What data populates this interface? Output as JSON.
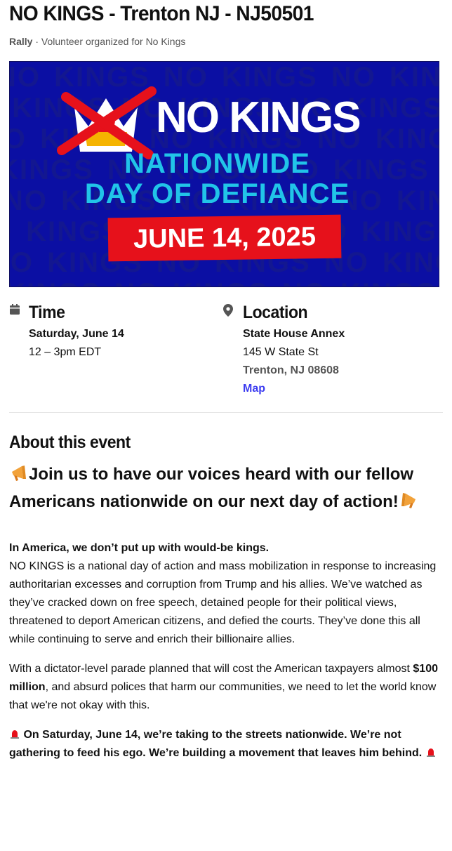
{
  "event": {
    "title": "NO KINGS - Trenton NJ - NJ50501",
    "type": "Rally",
    "organizer_text": "· Volunteer organized for No Kings"
  },
  "banner": {
    "line1": "NO KINGS",
    "line2": "NATIONWIDE",
    "line3": "DAY OF DEFIANCE",
    "date": "JUNE 14, 2025",
    "bg_word": "NO KINGS",
    "colors": {
      "background": "#0b0fa3",
      "accent": "#21c4e8",
      "date_plate": "#e6111b"
    }
  },
  "time": {
    "heading": "Time",
    "date": "Saturday, June 14",
    "hours": "12 – 3pm EDT",
    "icon": "calendar-icon"
  },
  "location": {
    "heading": "Location",
    "venue": "State House Annex",
    "street": "145 W State St",
    "city": "Trenton, NJ 08608",
    "map_link": "Map",
    "icon": "map-pin-icon"
  },
  "about": {
    "heading": "About this event",
    "headline": "Join us to have our voices heard with our fellow Americans nationwide on our next day of action!",
    "intro_bold": "In America, we don’t put up with would-be kings.",
    "para1": "NO KINGS is a national day of action and mass mobilization in response to increasing authoritarian excesses and corruption from Trump and his allies. We’ve watched as they’ve cracked down on free speech, detained people for their political views, threatened to deport American citizens, and defied the courts. They’ve done this all while continuing to serve and enrich their billionaire allies.",
    "para2_before": "With a dictator-level parade planned that will cost the American taxpayers almost ",
    "para2_bold": "$100 million",
    "para2_after": ", and absurd polices that harm our communities, we need to let the world know that we're not okay with this.",
    "closing": "On Saturday, June 14, we’re taking to the streets nationwide. We’re not gathering to feed his ego. We’re building a movement that leaves him behind."
  },
  "colors": {
    "link": "#3c3cf0",
    "muted": "#555555"
  }
}
